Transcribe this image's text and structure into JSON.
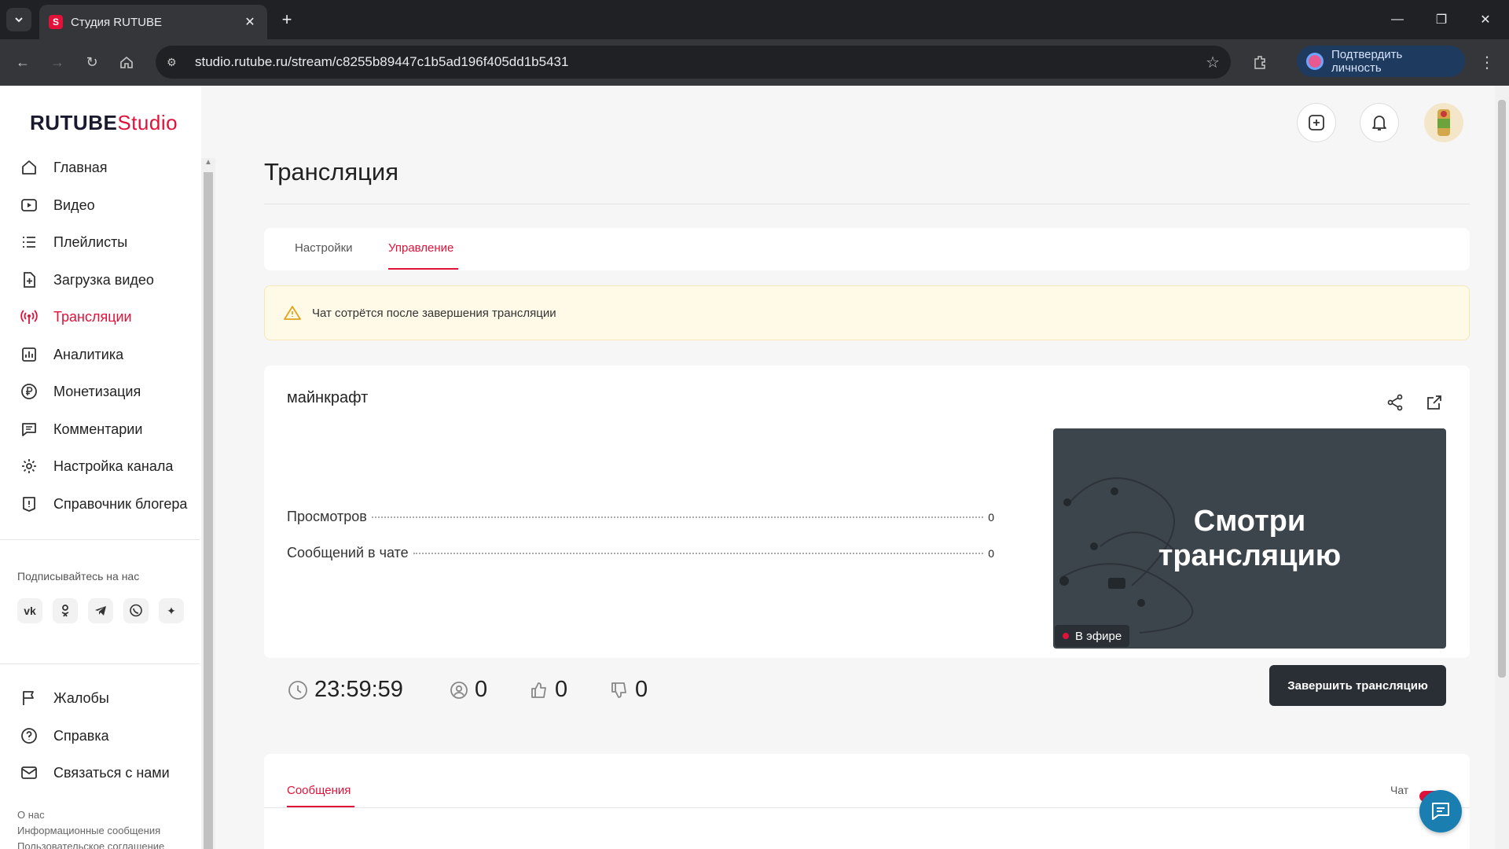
{
  "browser": {
    "tab_title": "Студия RUTUBE",
    "favicon_letter": "S",
    "url": "studio.rutube.ru/stream/c8255b89447c1b5ad196f405dd1b5431",
    "verify_label": "Подтвердить личность"
  },
  "logo": {
    "rutube": "RUTUBE",
    "studio": "Studio"
  },
  "sidebar": {
    "items": [
      {
        "label": "Главная",
        "icon": "home-icon"
      },
      {
        "label": "Видео",
        "icon": "video-icon"
      },
      {
        "label": "Плейлисты",
        "icon": "list-icon"
      },
      {
        "label": "Загрузка видео",
        "icon": "upload-icon"
      },
      {
        "label": "Трансляции",
        "icon": "broadcast-icon",
        "active": true
      },
      {
        "label": "Аналитика",
        "icon": "analytics-icon"
      },
      {
        "label": "Монетизация",
        "icon": "ruble-icon"
      },
      {
        "label": "Комментарии",
        "icon": "comment-icon"
      },
      {
        "label": "Настройка канала",
        "icon": "gear-icon"
      },
      {
        "label": "Справочник блогера",
        "icon": "info-icon"
      }
    ],
    "subscribe_label": "Подписывайтесь на нас",
    "social": [
      "vk-icon",
      "ok-icon",
      "telegram-icon",
      "viber-icon",
      "sparkle-icon"
    ],
    "bottom_items": [
      {
        "label": "Жалобы",
        "icon": "flag-icon"
      },
      {
        "label": "Справка",
        "icon": "help-icon"
      },
      {
        "label": "Связаться с нами",
        "icon": "mail-icon"
      }
    ],
    "footer_links": [
      "О нас",
      "Информационные сообщения",
      "Пользовательское соглашение"
    ]
  },
  "main": {
    "title": "Трансляция",
    "tabs": [
      "Настройки",
      "Управление"
    ],
    "active_tab": "Управление",
    "alert": "Чат сотрётся после завершения трансляции",
    "stream": {
      "name": "майнкрафт",
      "stats": [
        {
          "label": "Просмотров",
          "value": "0"
        },
        {
          "label": "Сообщений в чате",
          "value": "0"
        }
      ],
      "preview_text_line1": "Смотри",
      "preview_text_line2": "трансляцию",
      "live_label": "В эфире",
      "timer": "23:59:59",
      "viewers": "0",
      "likes": "0",
      "dislikes": "0",
      "end_button": "Завершить трансляцию"
    },
    "messages_tab": "Сообщения",
    "chat_label": "Чат"
  },
  "colors": {
    "accent": "#e0123a",
    "dark": "#2a2f35"
  }
}
